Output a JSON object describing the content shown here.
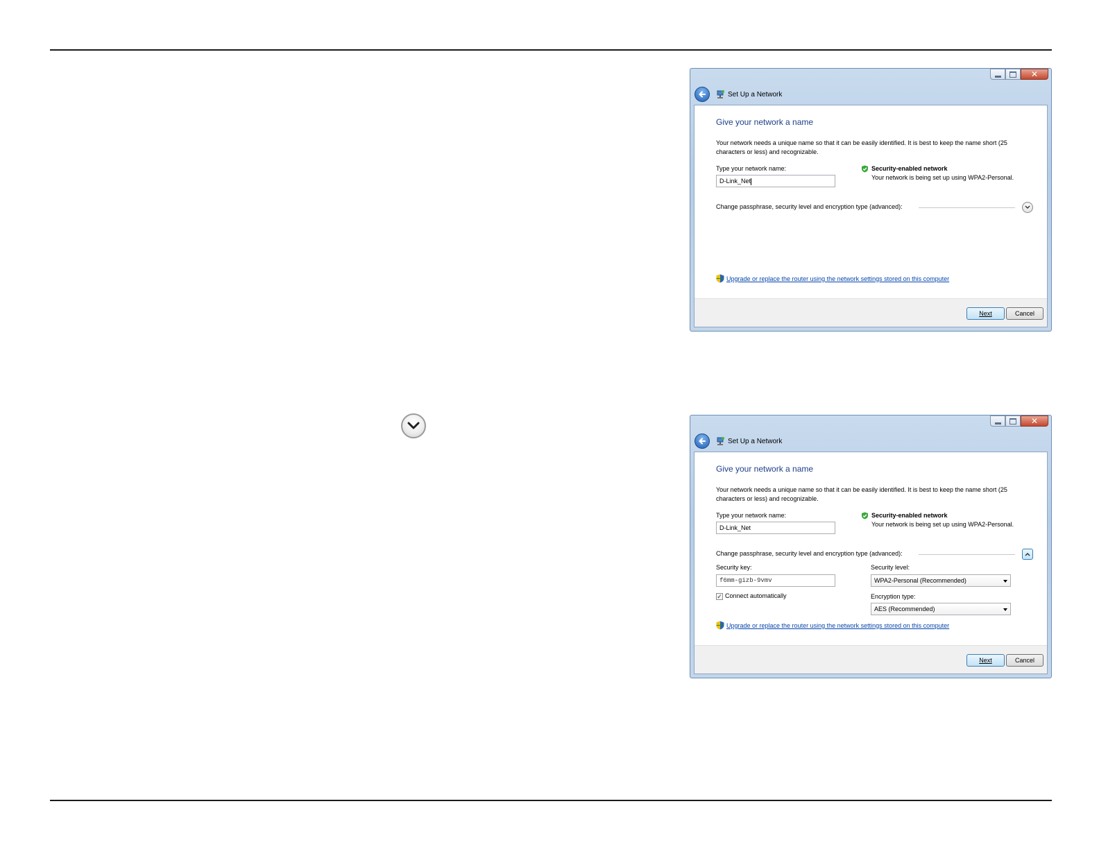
{
  "dialogs": [
    {
      "title": "Set Up a Network",
      "heading": "Give your network a name",
      "description": "Your network needs a unique name so that it can be easily identified. It is best to keep the name short (25 characters or less) and recognizable.",
      "network_name_label": "Type your network name:",
      "network_name_value": "D-Link_Net",
      "security_title": "Security-enabled network",
      "security_desc": "Your network is being set up using WPA2-Personal.",
      "advanced_label": "Change passphrase, security level and encryption type (advanced):",
      "router_link": "Upgrade or replace the router using the network settings stored on this computer",
      "next_button": "Next",
      "cancel_button": "Cancel",
      "advanced_expanded": false
    },
    {
      "title": "Set Up a Network",
      "heading": "Give your network a name",
      "description": "Your network needs a unique name so that it can be easily identified. It is best to keep the name short (25 characters or less) and recognizable.",
      "network_name_label": "Type your network name:",
      "network_name_value": "D-Link_Net",
      "security_title": "Security-enabled network",
      "security_desc": "Your network is being set up using WPA2-Personal.",
      "advanced_label": "Change passphrase, security level and encryption type (advanced):",
      "security_key_label": "Security key:",
      "security_key_value": "f6mm-gizb-9vmv",
      "security_level_label": "Security level:",
      "security_level_value": "WPA2-Personal (Recommended)",
      "connect_auto_label": "Connect automatically",
      "connect_auto_checked": true,
      "encryption_label": "Encryption type:",
      "encryption_value": "AES (Recommended)",
      "router_link": "Upgrade or replace the router using the network settings stored on this computer",
      "next_button": "Next",
      "cancel_button": "Cancel",
      "advanced_expanded": true
    }
  ],
  "icons": {
    "expand": "chevron-down-icon",
    "collapse": "chevron-up-icon",
    "back": "back-arrow-icon",
    "uac": "uac-shield-icon",
    "security": "shield-check-icon"
  },
  "colors": {
    "heading": "#1e3f8a",
    "link": "#0645ad",
    "security_check": "#3aa83a"
  }
}
